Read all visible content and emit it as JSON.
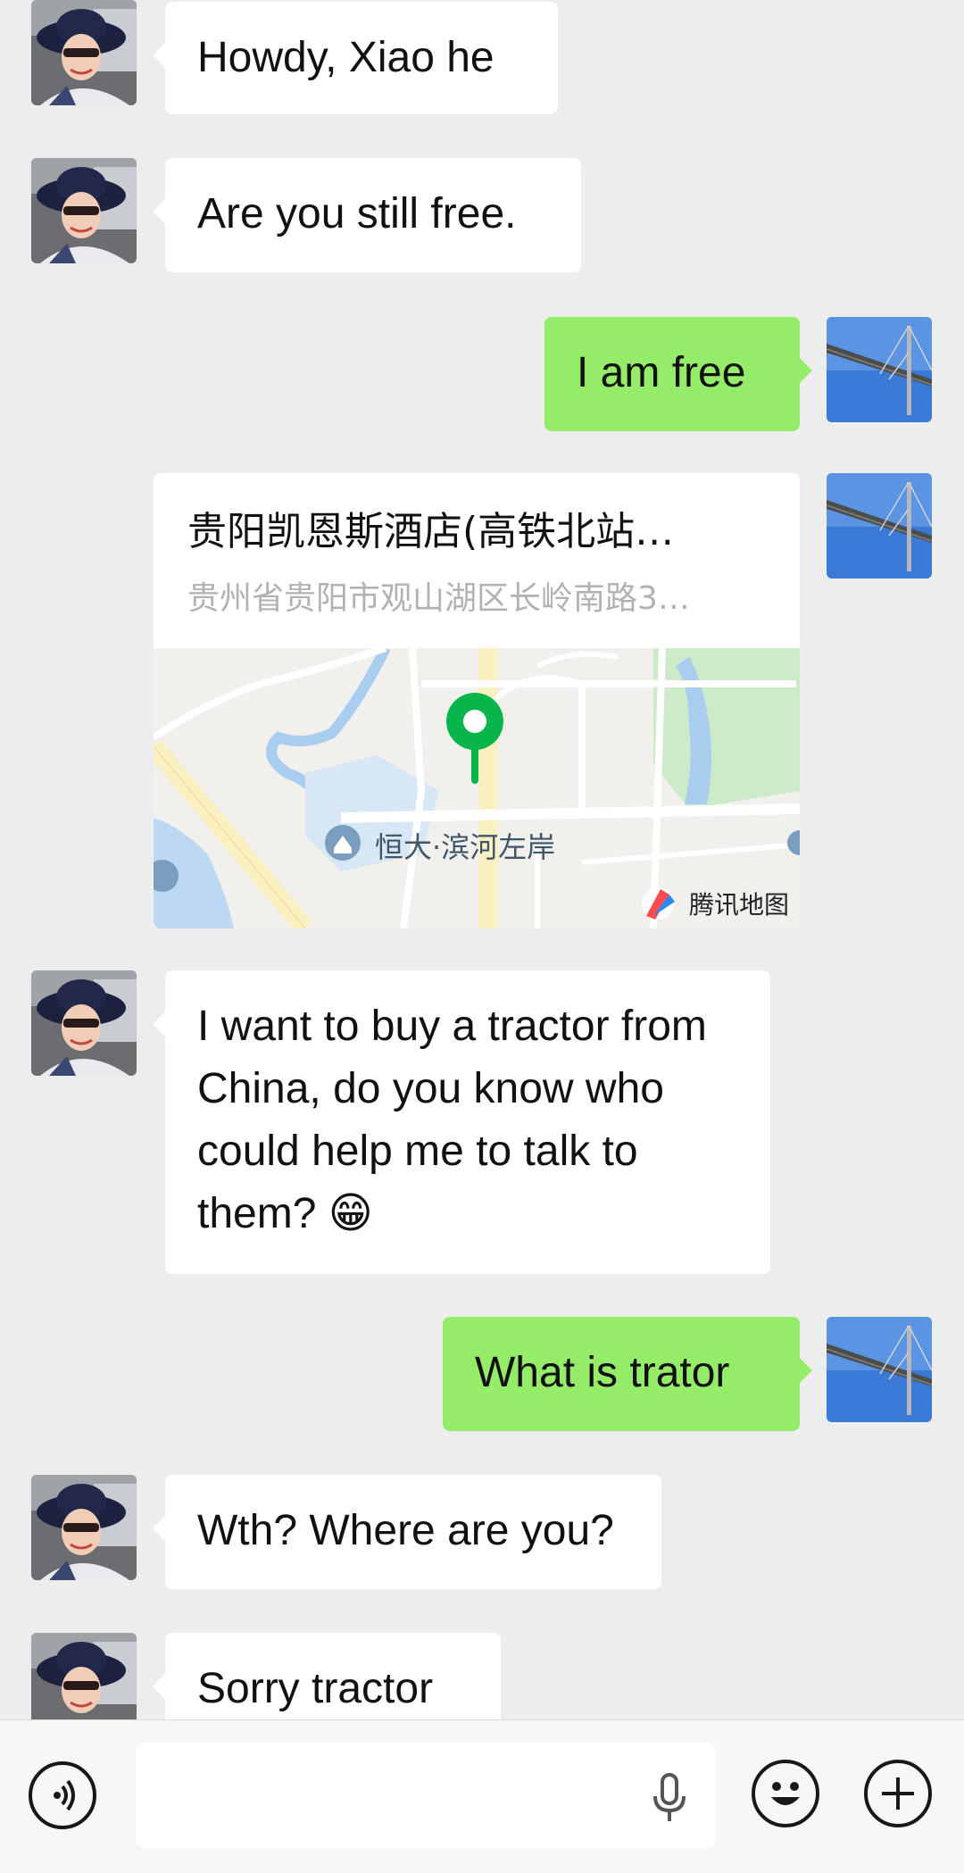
{
  "messages": [
    {
      "side": "in",
      "text": "Howdy, Xiao he"
    },
    {
      "side": "in",
      "text": "Are you still free."
    },
    {
      "side": "out",
      "text": "I am free"
    },
    {
      "side": "out",
      "type": "location"
    },
    {
      "side": "in",
      "text": "I want to buy a tractor from China, do you know who could help me to talk to them? 😁"
    },
    {
      "side": "out",
      "text": "What is trator"
    },
    {
      "side": "in",
      "text": "Wth? Where are you?"
    },
    {
      "side": "in",
      "text": "Sorry tractor"
    }
  ],
  "location": {
    "title": "贵阳凯恩斯酒店(高铁北站…",
    "address": "贵州省贵阳市观山湖区长岭南路3…",
    "map_label": "恒大·滨河左岸",
    "map_provider": "腾讯地图"
  },
  "input": {
    "voice_icon": "voice-icon",
    "mic_icon": "microphone-icon",
    "emoji_icon": "emoji-icon",
    "plus_icon": "plus-icon",
    "value": ""
  },
  "colors": {
    "background": "#ededed",
    "incoming_bubble": "#ffffff",
    "outgoing_bubble": "#95ec69"
  }
}
